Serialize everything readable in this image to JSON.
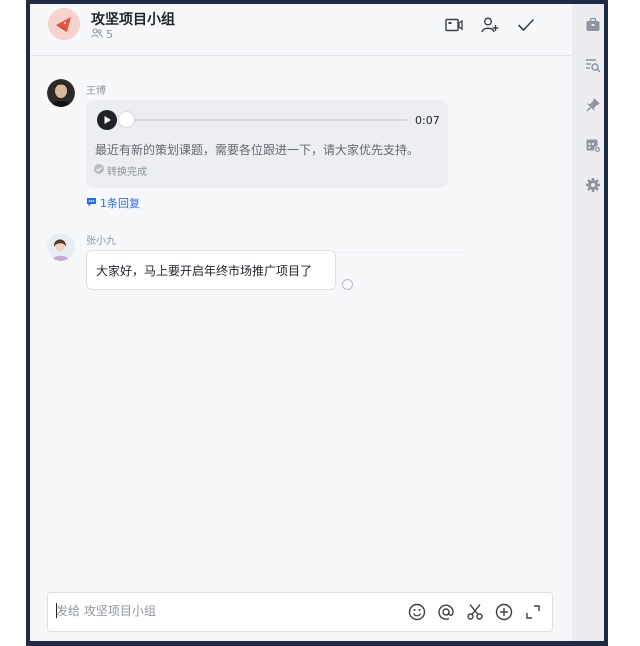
{
  "header": {
    "group_name": "攻坚项目小组",
    "member_count": "5",
    "icons": [
      "video-call-icon",
      "add-member-icon",
      "done-check-icon"
    ]
  },
  "sidebar": {
    "icons": [
      "briefcase-icon",
      "search-history-icon",
      "pin-icon",
      "calendar-add-icon",
      "settings-icon"
    ]
  },
  "messages": [
    {
      "sender": "王博",
      "type": "voice",
      "duration": "0:07",
      "transcript": "最近有新的策划课题，需要各位跟进一下，请大家优先支持。",
      "status": "转换完成",
      "reply_link": "1条回复"
    },
    {
      "sender": "张小九",
      "type": "text",
      "text": "大家好，马上要开启年终市场推广项目了"
    }
  ],
  "composer": {
    "placeholder": "发给 攻坚项目小组",
    "tools": [
      "emoji-icon",
      "mention-icon",
      "screenshot-icon",
      "add-icon",
      "expand-icon"
    ]
  },
  "colors": {
    "link": "#2a6fdb",
    "frame": "#1f2a44",
    "panel": "#f7f8fa"
  }
}
